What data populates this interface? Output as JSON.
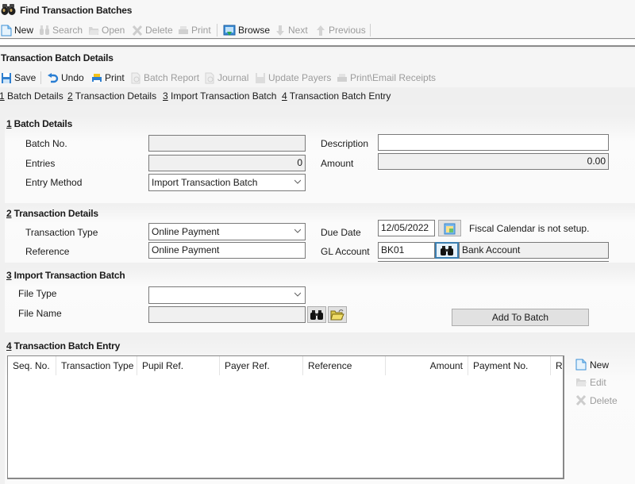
{
  "find_window": {
    "title": "Find Transaction Batches",
    "title_icon": "binoculars-icon",
    "toolbar": [
      {
        "label": "New",
        "icon": "new-document-icon",
        "enabled": true
      },
      {
        "label": "Search",
        "icon": "binoculars-icon",
        "enabled": false
      },
      {
        "label": "Open",
        "icon": "folder-open-icon",
        "enabled": false
      },
      {
        "label": "Delete",
        "icon": "delete-x-icon",
        "enabled": false
      },
      {
        "label": "Print",
        "icon": "printer-icon",
        "enabled": false
      },
      {
        "label": "Browse",
        "icon": "browse-icon",
        "enabled": true
      },
      {
        "label": "Next",
        "icon": "arrow-down-icon",
        "enabled": false
      },
      {
        "label": "Previous",
        "icon": "arrow-up-icon",
        "enabled": false
      }
    ]
  },
  "batch_window": {
    "title": "Transaction Batch Details",
    "toolbar": [
      {
        "label": "Save",
        "icon": "save-icon",
        "enabled": true
      },
      {
        "label": "Undo",
        "icon": "undo-icon",
        "enabled": true
      },
      {
        "label": "Print",
        "icon": "printer-icon",
        "enabled": true
      },
      {
        "label": "Batch Report",
        "icon": "report-icon",
        "enabled": false
      },
      {
        "label": "Journal",
        "icon": "report-icon",
        "enabled": false
      },
      {
        "label": "Update Payers",
        "icon": "save-icon",
        "enabled": false
      },
      {
        "label": "Print\\Email Receipts",
        "icon": "printer-icon",
        "enabled": false
      }
    ],
    "nav_links": [
      {
        "num": "1",
        "label": " Batch Details"
      },
      {
        "num": "2",
        "label": " Transaction Details"
      },
      {
        "num": "3",
        "label": " Import Transaction Batch"
      },
      {
        "num": "4",
        "label": " Transaction Batch Entry"
      }
    ]
  },
  "batch_details": {
    "num": "1",
    "title": " Batch Details",
    "batch_no_label": "Batch No.",
    "batch_no_value": "",
    "entries_label": "Entries",
    "entries_value": "0",
    "entry_method_label": "Entry Method",
    "entry_method_value": "Import Transaction Batch",
    "description_label": "Description",
    "description_value": "",
    "amount_label": "Amount",
    "amount_value": "0.00"
  },
  "transaction_details": {
    "num": "2",
    "title": " Transaction Details",
    "transaction_type_label": "Transaction Type",
    "transaction_type_value": "Online Payment",
    "reference_label": "Reference",
    "reference_value": "Online Payment",
    "due_date_label": "Due Date",
    "due_date_value": "12/05/2022",
    "fiscal_message": "Fiscal Calendar is not setup.",
    "gl_account_label": "GL Account",
    "gl_account_code": "BK01",
    "gl_account_name": "Bank Account"
  },
  "import_batch": {
    "num": "3",
    "title": " Import Transaction Batch",
    "file_type_label": "File Type",
    "file_type_value": "",
    "file_name_label": "File Name",
    "file_name_value": "",
    "add_button": "Add To Batch"
  },
  "batch_entry": {
    "num": "4",
    "title": " Transaction Batch Entry",
    "columns": [
      "Seq. No.",
      "Transaction Type",
      "Pupil Ref.",
      "Payer Ref.",
      "Reference",
      "Amount",
      "Payment No.",
      "Re"
    ],
    "rows": [],
    "actions": [
      {
        "label": "New",
        "icon": "new-document-icon",
        "enabled": true
      },
      {
        "label": "Edit",
        "icon": "folder-open-icon",
        "enabled": false
      },
      {
        "label": "Delete",
        "icon": "delete-x-icon",
        "enabled": false
      }
    ]
  }
}
